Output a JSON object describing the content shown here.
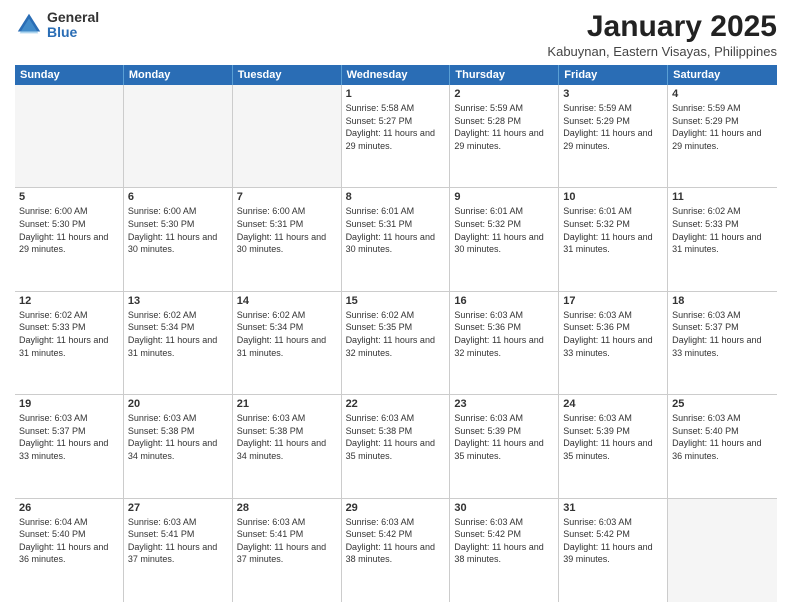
{
  "logo": {
    "general": "General",
    "blue": "Blue"
  },
  "title": {
    "month": "January 2025",
    "location": "Kabuynan, Eastern Visayas, Philippines"
  },
  "weekdays": [
    "Sunday",
    "Monday",
    "Tuesday",
    "Wednesday",
    "Thursday",
    "Friday",
    "Saturday"
  ],
  "weeks": [
    [
      {
        "day": "",
        "info": ""
      },
      {
        "day": "",
        "info": ""
      },
      {
        "day": "",
        "info": ""
      },
      {
        "day": "1",
        "info": "Sunrise: 5:58 AM\nSunset: 5:27 PM\nDaylight: 11 hours and 29 minutes."
      },
      {
        "day": "2",
        "info": "Sunrise: 5:59 AM\nSunset: 5:28 PM\nDaylight: 11 hours and 29 minutes."
      },
      {
        "day": "3",
        "info": "Sunrise: 5:59 AM\nSunset: 5:29 PM\nDaylight: 11 hours and 29 minutes."
      },
      {
        "day": "4",
        "info": "Sunrise: 5:59 AM\nSunset: 5:29 PM\nDaylight: 11 hours and 29 minutes."
      }
    ],
    [
      {
        "day": "5",
        "info": "Sunrise: 6:00 AM\nSunset: 5:30 PM\nDaylight: 11 hours and 29 minutes."
      },
      {
        "day": "6",
        "info": "Sunrise: 6:00 AM\nSunset: 5:30 PM\nDaylight: 11 hours and 30 minutes."
      },
      {
        "day": "7",
        "info": "Sunrise: 6:00 AM\nSunset: 5:31 PM\nDaylight: 11 hours and 30 minutes."
      },
      {
        "day": "8",
        "info": "Sunrise: 6:01 AM\nSunset: 5:31 PM\nDaylight: 11 hours and 30 minutes."
      },
      {
        "day": "9",
        "info": "Sunrise: 6:01 AM\nSunset: 5:32 PM\nDaylight: 11 hours and 30 minutes."
      },
      {
        "day": "10",
        "info": "Sunrise: 6:01 AM\nSunset: 5:32 PM\nDaylight: 11 hours and 31 minutes."
      },
      {
        "day": "11",
        "info": "Sunrise: 6:02 AM\nSunset: 5:33 PM\nDaylight: 11 hours and 31 minutes."
      }
    ],
    [
      {
        "day": "12",
        "info": "Sunrise: 6:02 AM\nSunset: 5:33 PM\nDaylight: 11 hours and 31 minutes."
      },
      {
        "day": "13",
        "info": "Sunrise: 6:02 AM\nSunset: 5:34 PM\nDaylight: 11 hours and 31 minutes."
      },
      {
        "day": "14",
        "info": "Sunrise: 6:02 AM\nSunset: 5:34 PM\nDaylight: 11 hours and 31 minutes."
      },
      {
        "day": "15",
        "info": "Sunrise: 6:02 AM\nSunset: 5:35 PM\nDaylight: 11 hours and 32 minutes."
      },
      {
        "day": "16",
        "info": "Sunrise: 6:03 AM\nSunset: 5:36 PM\nDaylight: 11 hours and 32 minutes."
      },
      {
        "day": "17",
        "info": "Sunrise: 6:03 AM\nSunset: 5:36 PM\nDaylight: 11 hours and 33 minutes."
      },
      {
        "day": "18",
        "info": "Sunrise: 6:03 AM\nSunset: 5:37 PM\nDaylight: 11 hours and 33 minutes."
      }
    ],
    [
      {
        "day": "19",
        "info": "Sunrise: 6:03 AM\nSunset: 5:37 PM\nDaylight: 11 hours and 33 minutes."
      },
      {
        "day": "20",
        "info": "Sunrise: 6:03 AM\nSunset: 5:38 PM\nDaylight: 11 hours and 34 minutes."
      },
      {
        "day": "21",
        "info": "Sunrise: 6:03 AM\nSunset: 5:38 PM\nDaylight: 11 hours and 34 minutes."
      },
      {
        "day": "22",
        "info": "Sunrise: 6:03 AM\nSunset: 5:38 PM\nDaylight: 11 hours and 35 minutes."
      },
      {
        "day": "23",
        "info": "Sunrise: 6:03 AM\nSunset: 5:39 PM\nDaylight: 11 hours and 35 minutes."
      },
      {
        "day": "24",
        "info": "Sunrise: 6:03 AM\nSunset: 5:39 PM\nDaylight: 11 hours and 35 minutes."
      },
      {
        "day": "25",
        "info": "Sunrise: 6:03 AM\nSunset: 5:40 PM\nDaylight: 11 hours and 36 minutes."
      }
    ],
    [
      {
        "day": "26",
        "info": "Sunrise: 6:04 AM\nSunset: 5:40 PM\nDaylight: 11 hours and 36 minutes."
      },
      {
        "day": "27",
        "info": "Sunrise: 6:03 AM\nSunset: 5:41 PM\nDaylight: 11 hours and 37 minutes."
      },
      {
        "day": "28",
        "info": "Sunrise: 6:03 AM\nSunset: 5:41 PM\nDaylight: 11 hours and 37 minutes."
      },
      {
        "day": "29",
        "info": "Sunrise: 6:03 AM\nSunset: 5:42 PM\nDaylight: 11 hours and 38 minutes."
      },
      {
        "day": "30",
        "info": "Sunrise: 6:03 AM\nSunset: 5:42 PM\nDaylight: 11 hours and 38 minutes."
      },
      {
        "day": "31",
        "info": "Sunrise: 6:03 AM\nSunset: 5:42 PM\nDaylight: 11 hours and 39 minutes."
      },
      {
        "day": "",
        "info": ""
      }
    ]
  ]
}
